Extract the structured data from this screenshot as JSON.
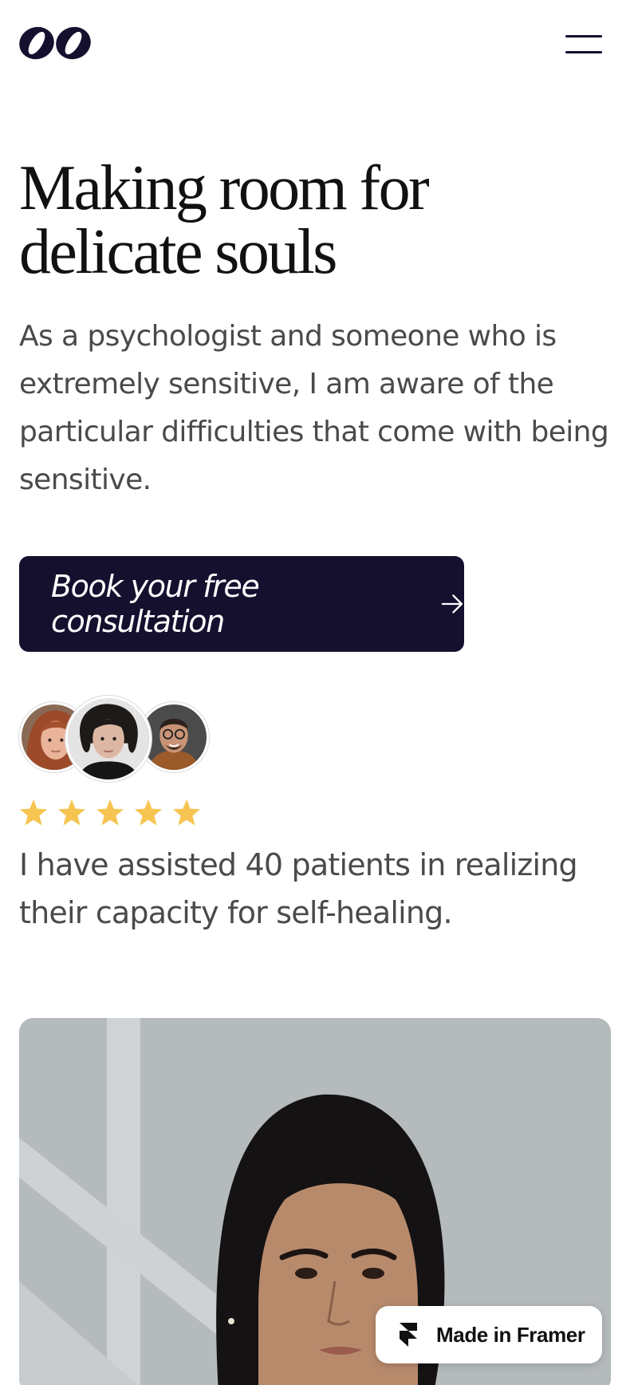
{
  "brand": {
    "logo_icon": "logo-oo-icon",
    "color": "#14102e"
  },
  "header": {
    "menu_icon": "hamburger-menu-icon"
  },
  "hero": {
    "title_line1": "Making room for",
    "title_line2": "delicate souls",
    "subtitle": "As a psychologist and someone who is extremely sensitive, I am aware of the particular difficulties that come with being sensitive."
  },
  "cta": {
    "label": "Book your free consultation",
    "icon": "arrow-right-icon"
  },
  "social_proof": {
    "avatars": [
      "patient-avatar-woman-red-hair",
      "patient-avatar-woman-dark-hair",
      "patient-avatar-man-glasses"
    ],
    "rating": 5,
    "rating_color": "#f6c451",
    "statement": "I have assisted 40 patients in realizing their capacity for self-healing."
  },
  "portrait": {
    "description_icon": "portrait-photo"
  },
  "badge": {
    "label": "Made in Framer",
    "icon": "framer-logo-icon"
  }
}
